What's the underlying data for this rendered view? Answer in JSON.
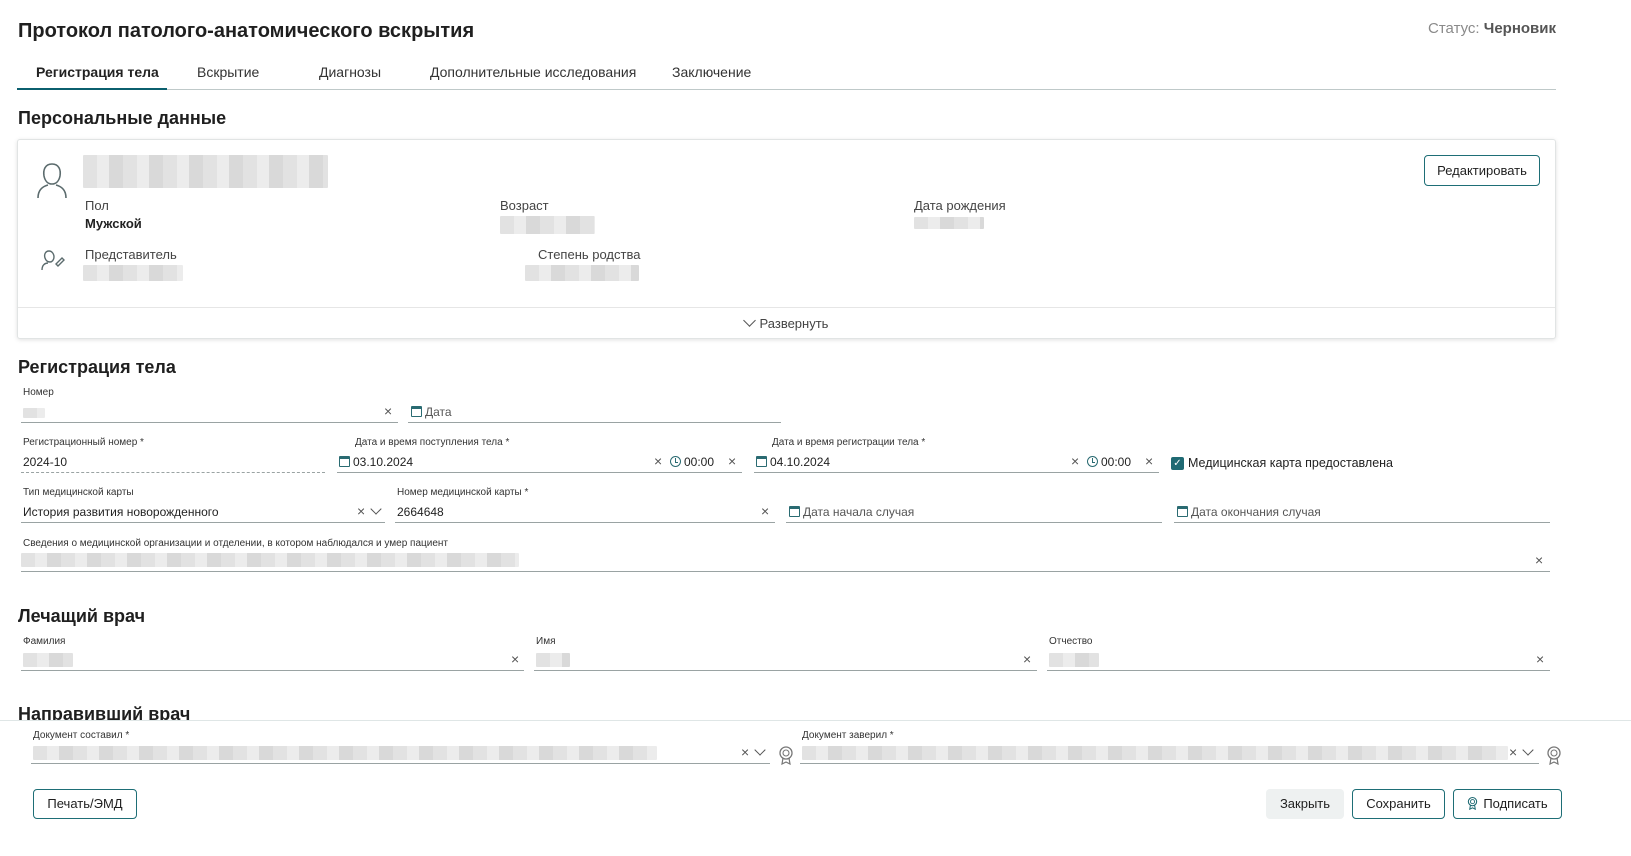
{
  "header": {
    "title": "Протокол патолого-анатомического вскрытия",
    "status_label": "Статус:",
    "status_value": "Черновик"
  },
  "tabs": [
    {
      "label": "Регистрация тела",
      "active": true
    },
    {
      "label": "Вскрытие"
    },
    {
      "label": "Диагнозы"
    },
    {
      "label": "Дополнительные исследования"
    },
    {
      "label": "Заключение"
    }
  ],
  "personal": {
    "section_title": "Персональные данные",
    "edit_button": "Редактировать",
    "sex_label": "Пол",
    "sex_value": "Мужской",
    "age_label": "Возраст",
    "birth_label": "Дата рождения",
    "representative_label": "Представитель",
    "relation_label": "Степень родства",
    "expand_label": "Развернуть"
  },
  "registration": {
    "section_title": "Регистрация тела",
    "number_label": "Номер",
    "date_placeholder": "Дата",
    "reg_number_label": "Регистрационный номер *",
    "reg_number_value": "2024-10",
    "arrival_label": "Дата и время поступления тела *",
    "arrival_date": "03.10.2024",
    "arrival_time": "00:00",
    "reg_dt_label": "Дата и время регистрации тела *",
    "reg_date": "04.10.2024",
    "reg_time": "00:00",
    "med_card_checkbox": "Медицинская карта предоставлена",
    "card_type_label": "Тип медицинской карты",
    "card_type_value": "История развития новорожденного",
    "card_number_label": "Номер медицинской карты *",
    "card_number_value": "2664648",
    "case_start_placeholder": "Дата начала случая",
    "case_end_placeholder": "Дата окончания случая",
    "org_label": "Сведения о медицинской организации и отделении, в котором наблюдался и умер пациент"
  },
  "doctor": {
    "section_title": "Лечащий врач",
    "surname_label": "Фамилия",
    "name_label": "Имя",
    "patronymic_label": "Отчество"
  },
  "referring": {
    "section_title": "Направивший врач"
  },
  "footer": {
    "composed_label": "Документ составил *",
    "certified_label": "Документ заверил *",
    "print_button": "Печать/ЭМД",
    "close_button": "Закрыть",
    "save_button": "Сохранить",
    "sign_button": "Подписать"
  },
  "colors": {
    "accent": "#1f6a73",
    "border": "#9aa3a3"
  }
}
